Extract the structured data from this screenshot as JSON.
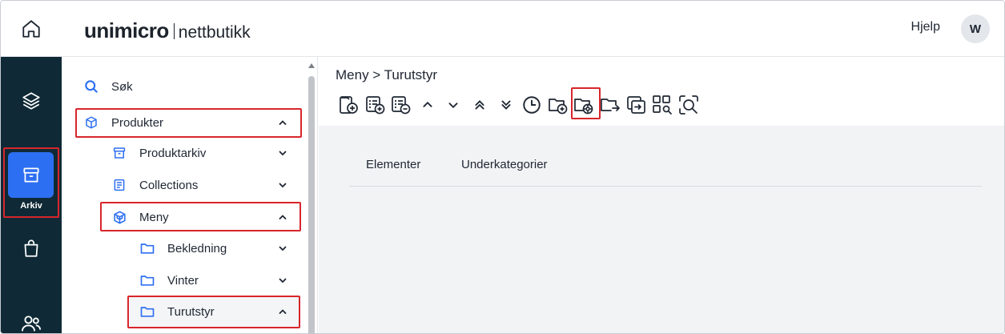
{
  "header": {
    "brand_main": "unimicro",
    "brand_sub": "nettbutikk",
    "help_label": "Hjelp",
    "avatar_initial": "W"
  },
  "rail": {
    "active_label": "Arkiv"
  },
  "tree": {
    "items": [
      {
        "label": "Søk",
        "icon": "search-icon"
      },
      {
        "label": "Produkter",
        "icon": "cube-icon",
        "expanded": true
      },
      {
        "label": "Produktarkiv",
        "icon": "archive-icon",
        "expanded": false
      },
      {
        "label": "Collections",
        "icon": "clipboard-list-icon",
        "expanded": false
      },
      {
        "label": "Meny",
        "icon": "cubes-icon",
        "expanded": true
      },
      {
        "label": "Bekledning",
        "icon": "folder-icon",
        "expanded": false
      },
      {
        "label": "Vinter",
        "icon": "folder-icon",
        "expanded": false
      },
      {
        "label": "Turutstyr",
        "icon": "folder-icon",
        "expanded": true,
        "selected": true
      }
    ]
  },
  "main": {
    "breadcrumb": "Meny > Turutstyr",
    "toolbar": [
      "add-folder-icon",
      "add-list-icon",
      "remove-list-icon",
      "chevron-up-icon",
      "chevron-down-icon",
      "double-chevron-up-icon",
      "double-chevron-down-icon",
      "clock-icon",
      "folder-add-icon",
      "folder-settings-icon",
      "folder-move-icon",
      "copy-to-icon",
      "grid-search-icon",
      "preview-search-icon"
    ],
    "tabs": [
      {
        "label": "Elementer"
      },
      {
        "label": "Underkategorier"
      }
    ]
  },
  "colors": {
    "rail_bg": "#0f2a36",
    "accent": "#2d6ff2",
    "highlight": "#d7262b"
  }
}
